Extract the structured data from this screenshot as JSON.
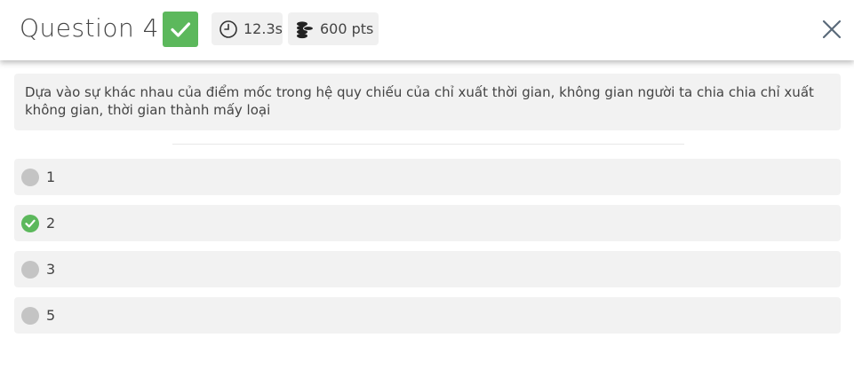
{
  "header": {
    "title": "Question 4",
    "time": "12.3s",
    "points": "600 pts",
    "correct_icon": "check-icon",
    "time_icon": "clock-icon",
    "points_icon": "coins-icon",
    "close_icon": "close-icon"
  },
  "question": {
    "text": "Dựa vào sự khác nhau của điểm mốc trong hệ quy chiếu của chỉ xuất thời gian, không gian người ta chia chia chỉ xuất không gian, thời gian thành mấy loại"
  },
  "answers": [
    {
      "label": "1",
      "correct": false
    },
    {
      "label": "2",
      "correct": true
    },
    {
      "label": "3",
      "correct": false
    },
    {
      "label": "5",
      "correct": false
    }
  ],
  "colors": {
    "correct": "#5cb85c",
    "neutral_dot": "#c4c4c4",
    "panel": "#f2f2f2"
  }
}
